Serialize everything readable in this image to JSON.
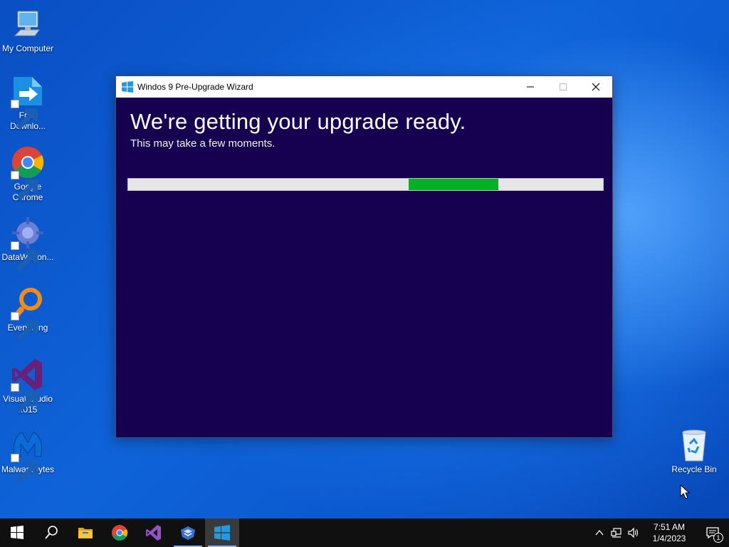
{
  "desktop": {
    "icons": [
      {
        "label": "My Computer",
        "icon": "monitor-icon"
      },
      {
        "label": "Free Downlo...",
        "icon": "free-download-manager-icon"
      },
      {
        "label": "Google Chrome",
        "icon": "chrome-icon"
      },
      {
        "label": "DataWagon...",
        "icon": "datawagon-icon"
      },
      {
        "label": "Everything",
        "icon": "everything-search-icon"
      },
      {
        "label": "Visual Studio 2015",
        "icon": "visual-studio-icon"
      },
      {
        "label": "Malwarebytes",
        "icon": "malwarebytes-icon"
      }
    ],
    "recycle_bin": {
      "label": "Recycle Bin",
      "icon": "recycle-bin-icon"
    }
  },
  "window": {
    "title": "Windos 9 Pre-Upgrade Wizard",
    "heading": "We're getting your upgrade ready.",
    "subheading": "This may take a few moments.",
    "progress": {
      "segment_start": 0.59,
      "segment_end": 0.78
    },
    "colors": {
      "background": "#160050",
      "progress_fill": "#06b025",
      "progress_track": "#e6e6e6"
    }
  },
  "taskbar": {
    "items": [
      "start-icon",
      "search-icon",
      "file-explorer-icon",
      "chrome-icon",
      "visual-studio-icon",
      "datawagon-icon",
      "windows-logo-icon"
    ],
    "clock": {
      "time": "7:51 AM",
      "date": "1/4/2023"
    },
    "notification_count": "1"
  }
}
